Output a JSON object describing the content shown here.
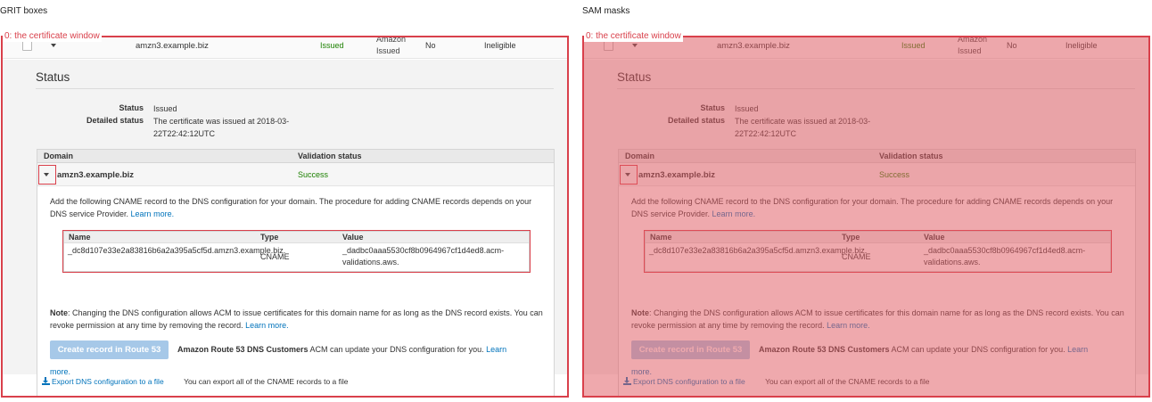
{
  "labels": {
    "left_pane": "GRIT boxes",
    "right_pane": "SAM masks",
    "window_tag": "0: the certificate window"
  },
  "top_row": {
    "domain": "amzn3.example.biz",
    "status": "Issued",
    "type": "Amazon Issued",
    "in_use": "No",
    "renewal": "Ineligible"
  },
  "status": {
    "title": "Status",
    "status_label": "Status",
    "status_value": "Issued",
    "detailed_label": "Detailed status",
    "detailed_value": "The certificate was issued at 2018-03-22T22:42:12UTC"
  },
  "domain_table": {
    "col_domain": "Domain",
    "col_validation": "Validation status",
    "row_domain": "amzn3.example.biz",
    "row_status": "Success"
  },
  "cname": {
    "instructions": "Add the following CNAME record to the DNS configuration for your domain. The procedure for adding CNAME records depends on your DNS service Provider.",
    "learn_more": "Learn more.",
    "col_name": "Name",
    "col_type": "Type",
    "col_value": "Value",
    "name": "_dc8d107e33e2a83816b6a2a395a5cf5d.amzn3.example.biz.",
    "type": "CNAME",
    "value": "_dadbc0aaa5530cf8b0964967cf1d4ed8.acm-validations.aws."
  },
  "note": {
    "label": "Note",
    "text": ": Changing the DNS configuration allows ACM to issue certificates for this domain name for as long as the DNS record exists. You can revoke permission at any time by removing the record.",
    "learn_more": "Learn more."
  },
  "route53": {
    "button": "Create record in Route 53",
    "bold": "Amazon Route 53 DNS Customers",
    "text": " ACM can update your DNS configuration for you.",
    "learn_more": "Learn more."
  },
  "export": {
    "link": "Export DNS configuration to a file",
    "note": "You can export all of the CNAME records to a file"
  },
  "colors": {
    "box": "#d9404b",
    "success": "#1d8102",
    "link": "#0073bb",
    "mask": "#e05a62"
  }
}
